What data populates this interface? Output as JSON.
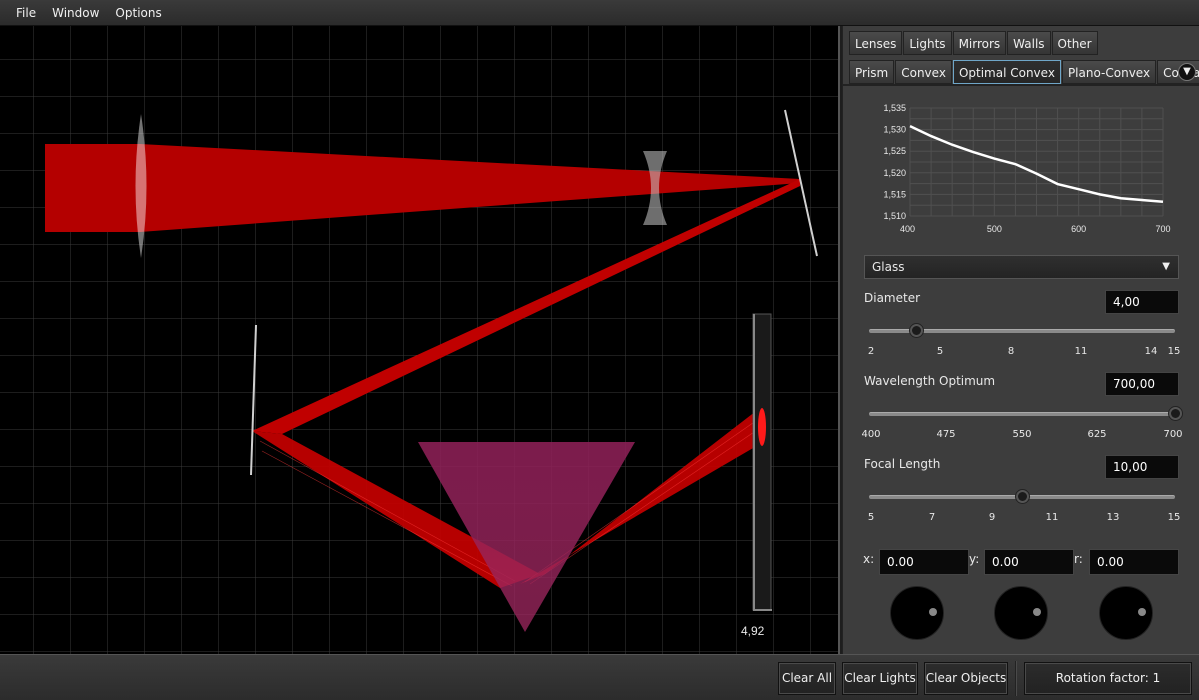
{
  "menu": [
    "File",
    "Window",
    "Options"
  ],
  "canvas": {
    "detector_readout": "4,92"
  },
  "tabs": {
    "categories": [
      {
        "label": "Lenses",
        "active": false
      },
      {
        "label": "Lights",
        "active": false
      },
      {
        "label": "Mirrors",
        "active": false
      },
      {
        "label": "Walls",
        "active": false
      },
      {
        "label": "Other",
        "active": false
      }
    ],
    "lens_types": [
      {
        "label": "Prism",
        "active": false
      },
      {
        "label": "Convex",
        "active": false
      },
      {
        "label": "Optimal Convex",
        "active": true
      },
      {
        "label": "Plano-Convex",
        "active": false
      },
      {
        "label": "Concave",
        "active": false
      }
    ],
    "overflow_icon": "chevron-down-icon"
  },
  "chart_data": {
    "type": "line",
    "title": "",
    "xlabel": "",
    "ylabel": "",
    "x_ticks": [
      "400",
      "500",
      "600",
      "700"
    ],
    "y_ticks": [
      "1,535",
      "1,530",
      "1,525",
      "1,520",
      "1,515",
      "1,510"
    ],
    "xlim": [
      400,
      700
    ],
    "ylim": [
      1.51,
      1.535
    ],
    "grid": true,
    "series": [
      {
        "x": [
          400,
          425,
          450,
          475,
          500,
          525,
          550,
          575,
          600,
          625,
          650,
          675,
          700
        ],
        "values": [
          1.5308,
          1.5285,
          1.5265,
          1.5248,
          1.5233,
          1.522,
          1.5198,
          1.5174,
          1.5162,
          1.515,
          1.5141,
          1.5137,
          1.5133
        ]
      }
    ]
  },
  "material": {
    "selected": "Glass"
  },
  "diameter": {
    "label": "Diameter",
    "value": "4,00",
    "min": 2,
    "max": 15,
    "current": 4,
    "ticks": [
      "2",
      "5",
      "8",
      "11",
      "14",
      "15"
    ]
  },
  "wavelength": {
    "label": "Wavelength Optimum",
    "value": "700,00",
    "min": 400,
    "max": 700,
    "current": 700,
    "ticks": [
      "400",
      "475",
      "550",
      "625",
      "700"
    ]
  },
  "focal": {
    "label": "Focal Length",
    "value": "10,00",
    "min": 5,
    "max": 15,
    "current": 10,
    "ticks": [
      "5",
      "7",
      "9",
      "11",
      "13",
      "15"
    ]
  },
  "coords": {
    "x_label": "x:",
    "x_value": "0.00",
    "y_label": "y:",
    "y_value": "0.00",
    "r_label": "r:",
    "r_value": "0.00"
  },
  "bottom": {
    "clear_all": "Clear All",
    "clear_lights": "Clear Lights",
    "clear_objects": "Clear Objects",
    "rotation": "Rotation factor: 1"
  },
  "colors": {
    "beam": "#c80000",
    "background": "#000000",
    "panel": "#3d3d3d",
    "accent": "#6fa6c8"
  }
}
